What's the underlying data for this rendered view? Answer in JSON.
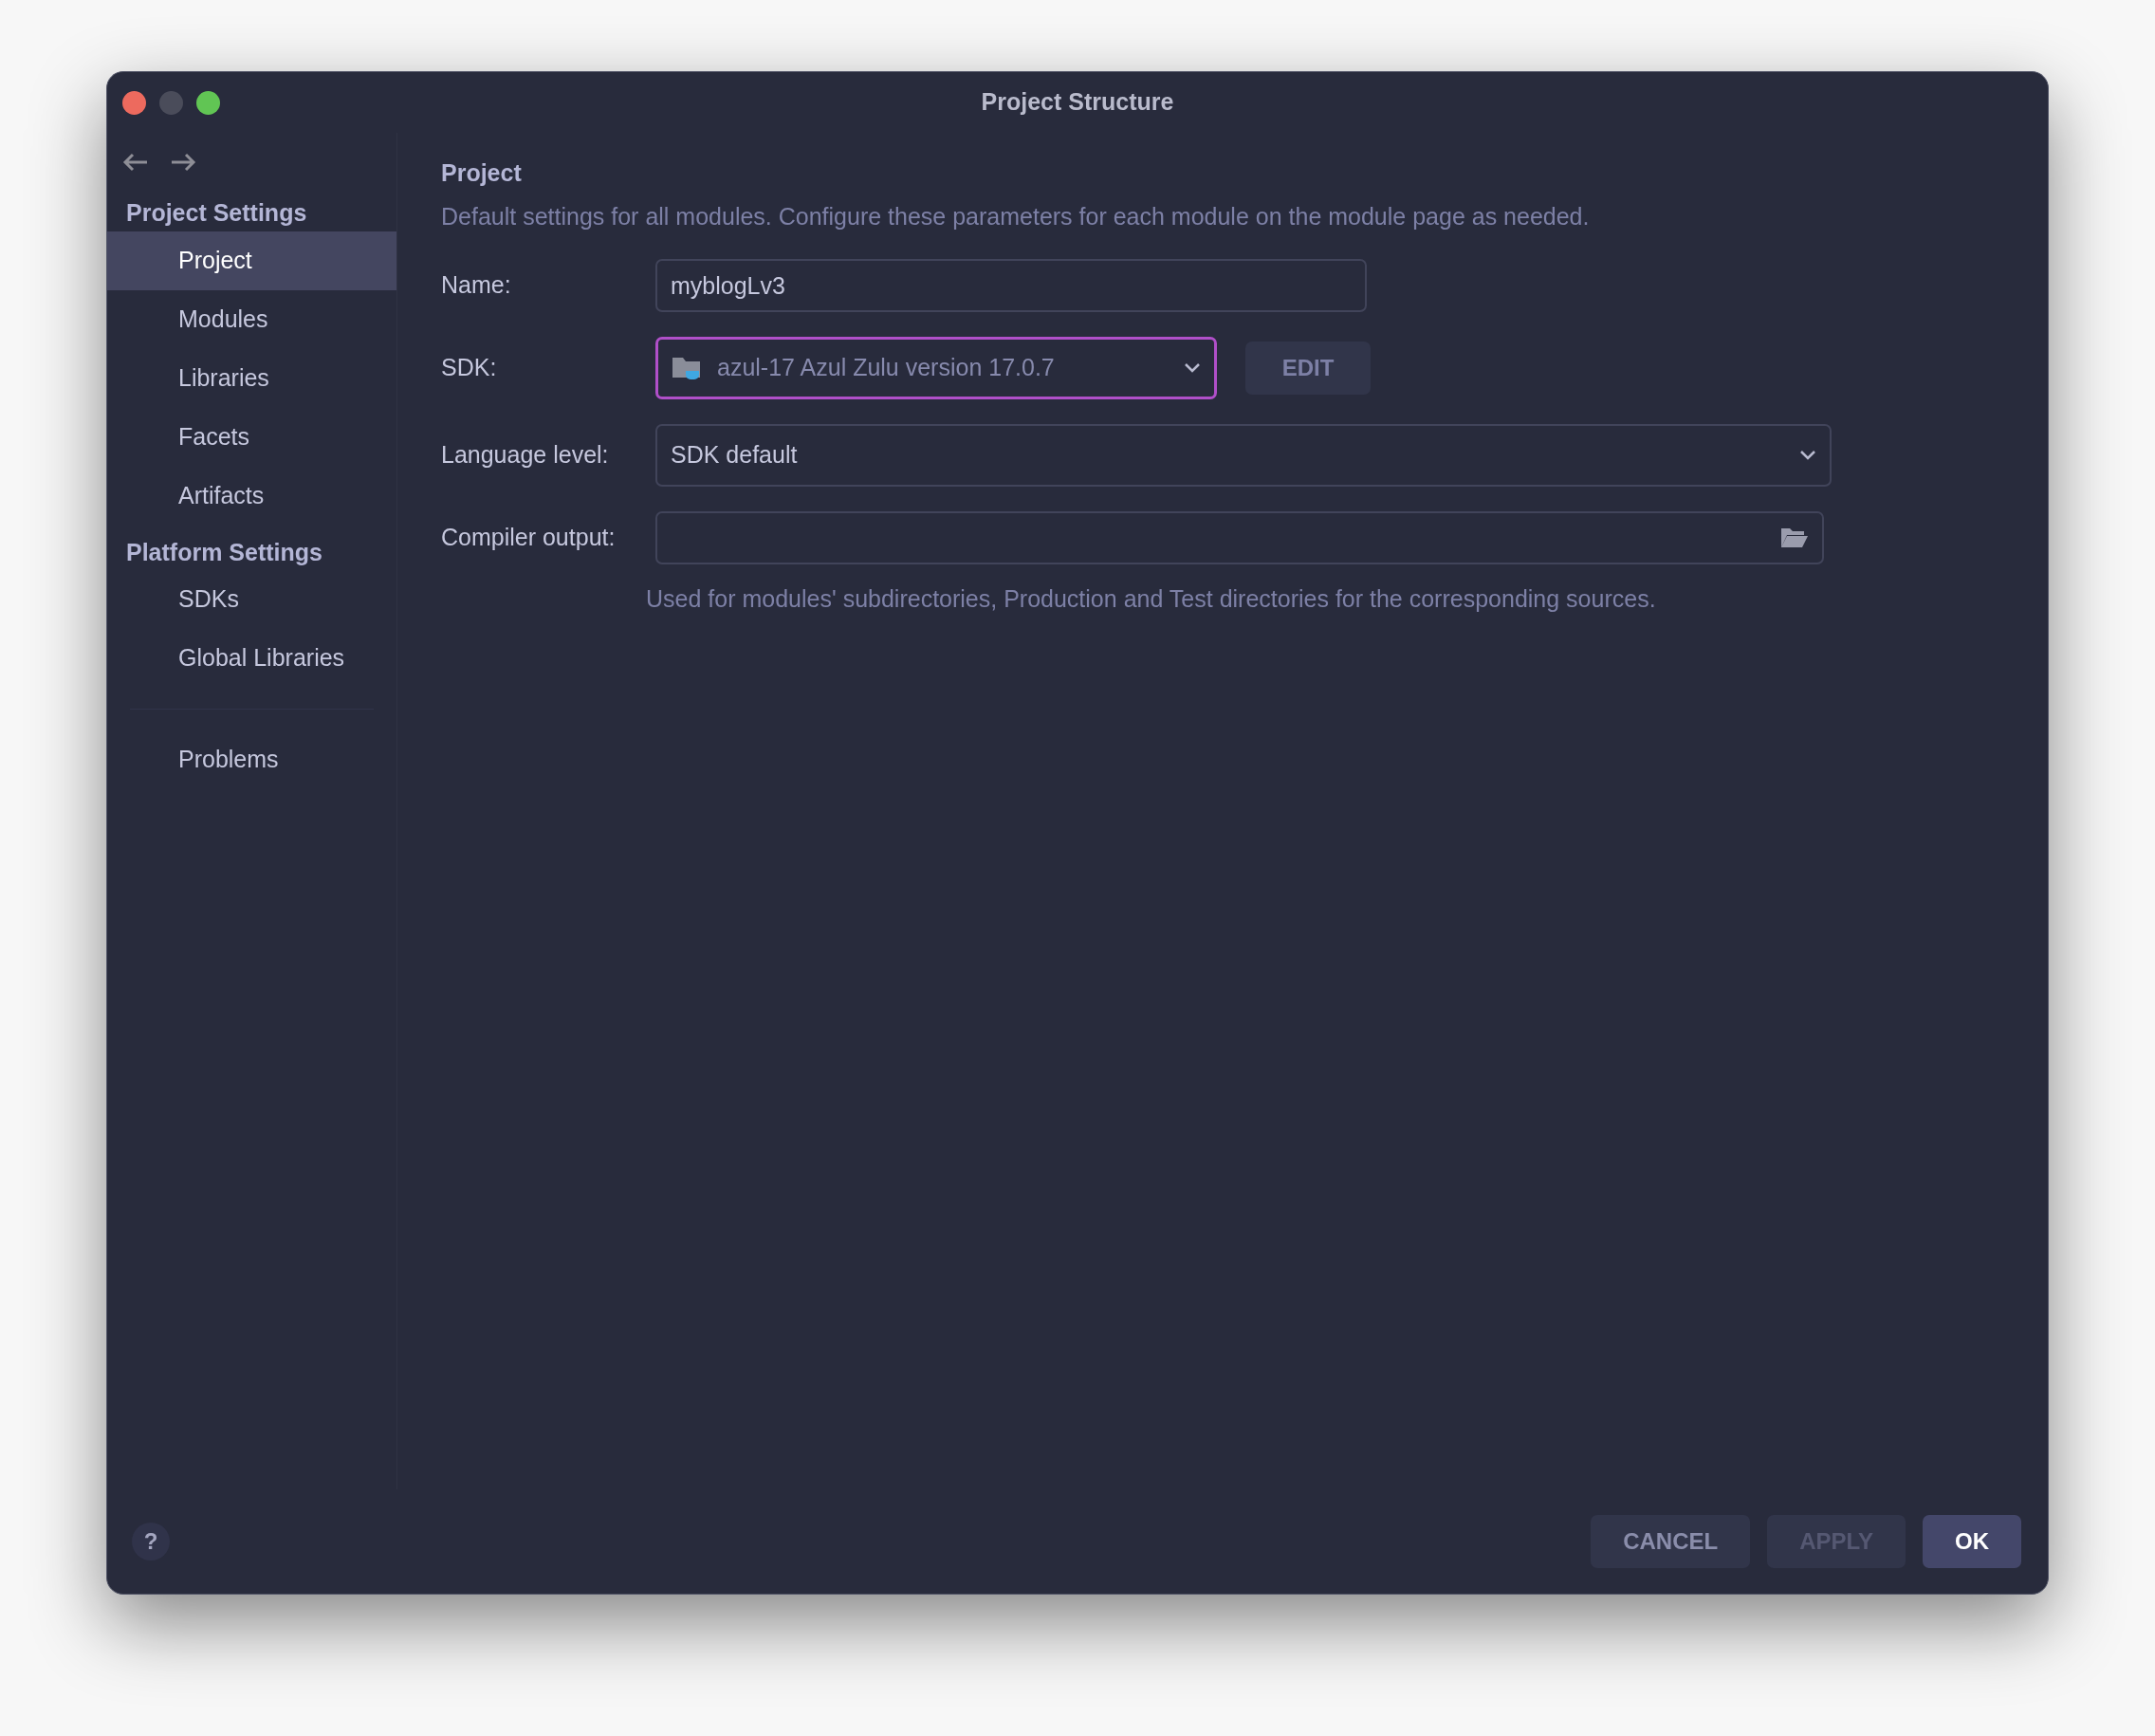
{
  "window": {
    "title": "Project Structure"
  },
  "sidebar": {
    "sections": [
      {
        "heading": "Project Settings",
        "items": [
          {
            "label": "Project",
            "selected": true
          },
          {
            "label": "Modules",
            "selected": false
          },
          {
            "label": "Libraries",
            "selected": false
          },
          {
            "label": "Facets",
            "selected": false
          },
          {
            "label": "Artifacts",
            "selected": false
          }
        ]
      },
      {
        "heading": "Platform Settings",
        "items": [
          {
            "label": "SDKs",
            "selected": false
          },
          {
            "label": "Global Libraries",
            "selected": false
          }
        ]
      }
    ],
    "footer_items": [
      {
        "label": "Problems",
        "selected": false
      }
    ]
  },
  "panel": {
    "title": "Project",
    "description": "Default settings for all modules. Configure these parameters for each module on the module page as needed.",
    "name_field": {
      "label": "Name:",
      "value": "myblogLv3"
    },
    "sdk_field": {
      "label": "SDK:",
      "value": "azul-17 Azul Zulu version 17.0.7",
      "focused": true,
      "button": "EDIT"
    },
    "language_level": {
      "label": "Language level:",
      "value": "SDK default"
    },
    "compiler_output": {
      "label": "Compiler output:",
      "hint": "Used for modules' subdirectories, Production and Test directories for the corresponding sources."
    }
  },
  "buttons": [
    {
      "label": "CANCEL",
      "kind": "default",
      "disabled": false
    },
    {
      "label": "APPLY",
      "kind": "default",
      "disabled": true
    },
    {
      "label": "OK",
      "kind": "primary",
      "disabled": false
    }
  ],
  "help": "?"
}
